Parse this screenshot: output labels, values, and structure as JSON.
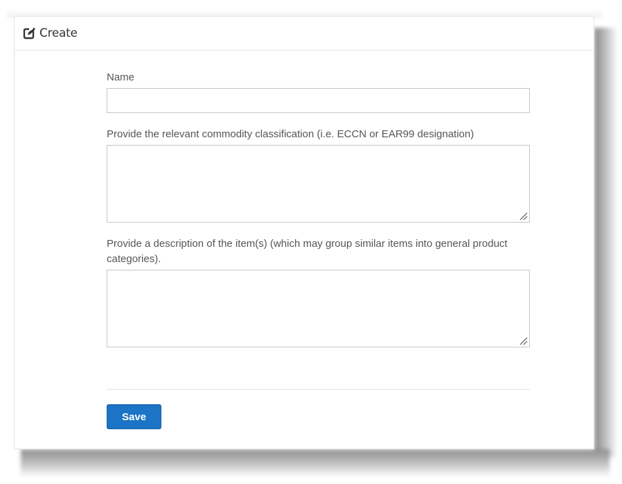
{
  "header": {
    "title": "Create",
    "icon": "edit-icon"
  },
  "form": {
    "name_label": "Name",
    "name_value": "",
    "classification_label": "Provide the relevant commodity classification (i.e. ECCN or EAR99 designation)",
    "classification_value": "",
    "description_label": "Provide a description of the item(s) (which may group similar items into general product categories).",
    "description_value": ""
  },
  "actions": {
    "save_label": "Save"
  },
  "colors": {
    "primary": "#1b74c5",
    "label_text": "#555555",
    "border": "#c6c6c6"
  }
}
